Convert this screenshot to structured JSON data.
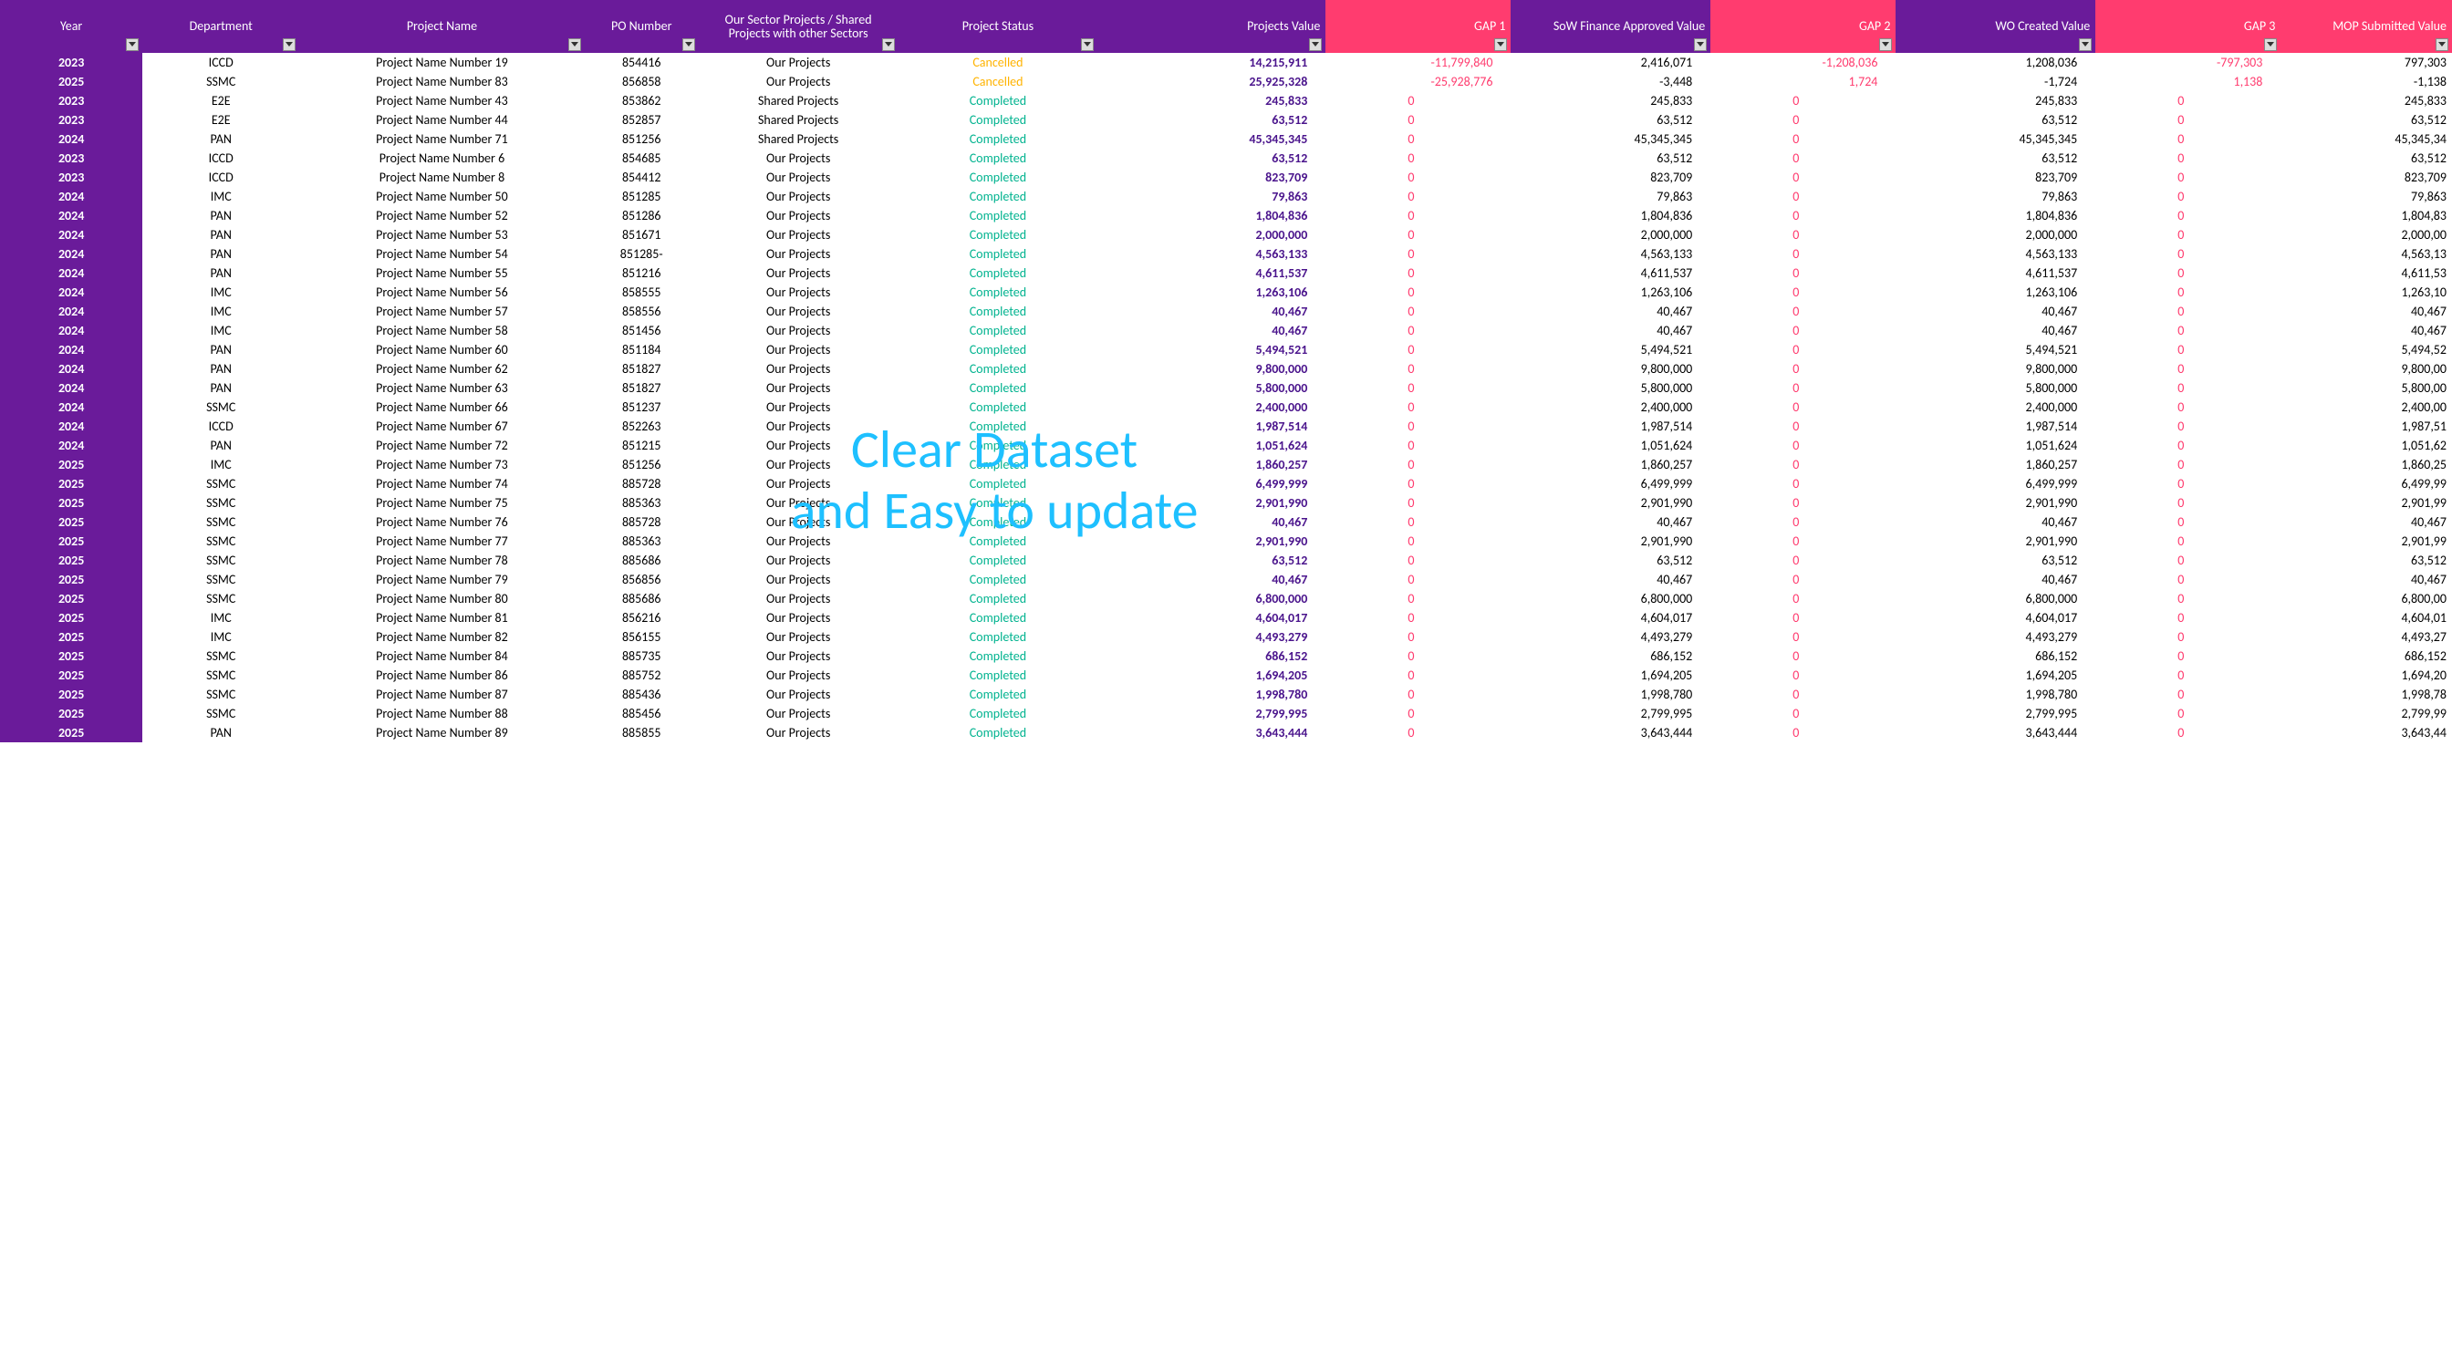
{
  "headers": [
    {
      "key": "year",
      "label": "Year",
      "cls": "c-year",
      "gap": false
    },
    {
      "key": "dept",
      "label": "Department",
      "cls": "c-dept",
      "gap": false
    },
    {
      "key": "pname",
      "label": "Project Name",
      "cls": "c-pname",
      "gap": false
    },
    {
      "key": "po",
      "label": "PO Number",
      "cls": "c-po",
      "gap": false
    },
    {
      "key": "sector",
      "label": "Our Sector Projects / Shared Projects with other Sectors",
      "cls": "c-sector",
      "gap": false
    },
    {
      "key": "status",
      "label": "Project Status",
      "cls": "c-status",
      "gap": false
    },
    {
      "key": "value",
      "label": "Projects Value",
      "cls": "c-value",
      "gap": false
    },
    {
      "key": "gap1",
      "label": "GAP 1",
      "cls": "c-gap",
      "gap": true
    },
    {
      "key": "sow",
      "label": "SoW Finance Approved Value",
      "cls": "c-money",
      "gap": false
    },
    {
      "key": "gap2",
      "label": "GAP 2",
      "cls": "c-gap",
      "gap": true
    },
    {
      "key": "wo",
      "label": "WO Created Value",
      "cls": "c-money",
      "gap": false
    },
    {
      "key": "gap3",
      "label": "GAP 3",
      "cls": "c-gap",
      "gap": true
    },
    {
      "key": "mop",
      "label": "MOP Submitted Value",
      "cls": "c-last",
      "gap": true
    }
  ],
  "watermark": "Clear Dataset\nand Easy to update",
  "rows": [
    {
      "year": "2023",
      "dept": "ICCD",
      "pname": "Project Name Number 19",
      "po": "854416",
      "sector": "Our Projects",
      "status": "Cancelled",
      "value": "14,215,911",
      "gap1": "-11,799,840",
      "sow": "2,416,071",
      "gap2": "-1,208,036",
      "wo": "1,208,036",
      "gap3": "-797,303",
      "mop": "797,303"
    },
    {
      "year": "2025",
      "dept": "SSMC",
      "pname": "Project Name Number 83",
      "po": "856858",
      "sector": "Our Projects",
      "status": "Cancelled",
      "value": "25,925,328",
      "gap1": "-25,928,776",
      "sow": "-3,448",
      "gap2": "1,724",
      "wo": "-1,724",
      "gap3": "1,138",
      "mop": "-1,138"
    },
    {
      "year": "2023",
      "dept": "E2E",
      "pname": "Project Name Number 43",
      "po": "853862",
      "sector": "Shared Projects",
      "status": "Completed",
      "value": "245,833",
      "gap1": "0",
      "sow": "245,833",
      "gap2": "0",
      "wo": "245,833",
      "gap3": "0",
      "mop": "245,833"
    },
    {
      "year": "2023",
      "dept": "E2E",
      "pname": "Project Name Number 44",
      "po": "852857",
      "sector": "Shared Projects",
      "status": "Completed",
      "value": "63,512",
      "gap1": "0",
      "sow": "63,512",
      "gap2": "0",
      "wo": "63,512",
      "gap3": "0",
      "mop": "63,512"
    },
    {
      "year": "2024",
      "dept": "PAN",
      "pname": "Project Name Number 71",
      "po": "851256",
      "sector": "Shared Projects",
      "status": "Completed",
      "value": "45,345,345",
      "gap1": "0",
      "sow": "45,345,345",
      "gap2": "0",
      "wo": "45,345,345",
      "gap3": "0",
      "mop": "45,345,34"
    },
    {
      "year": "2023",
      "dept": "ICCD",
      "pname": "Project Name Number 6",
      "po": "854685",
      "sector": "Our Projects",
      "status": "Completed",
      "value": "63,512",
      "gap1": "0",
      "sow": "63,512",
      "gap2": "0",
      "wo": "63,512",
      "gap3": "0",
      "mop": "63,512"
    },
    {
      "year": "2023",
      "dept": "ICCD",
      "pname": "Project Name Number 8",
      "po": "854412",
      "sector": "Our Projects",
      "status": "Completed",
      "value": "823,709",
      "gap1": "0",
      "sow": "823,709",
      "gap2": "0",
      "wo": "823,709",
      "gap3": "0",
      "mop": "823,709"
    },
    {
      "year": "2024",
      "dept": "IMC",
      "pname": "Project Name Number 50",
      "po": "851285",
      "sector": "Our Projects",
      "status": "Completed",
      "value": "79,863",
      "gap1": "0",
      "sow": "79,863",
      "gap2": "0",
      "wo": "79,863",
      "gap3": "0",
      "mop": "79,863"
    },
    {
      "year": "2024",
      "dept": "PAN",
      "pname": "Project Name Number 52",
      "po": "851286",
      "sector": "Our Projects",
      "status": "Completed",
      "value": "1,804,836",
      "gap1": "0",
      "sow": "1,804,836",
      "gap2": "0",
      "wo": "1,804,836",
      "gap3": "0",
      "mop": "1,804,83"
    },
    {
      "year": "2024",
      "dept": "PAN",
      "pname": "Project Name Number 53",
      "po": "851671",
      "sector": "Our Projects",
      "status": "Completed",
      "value": "2,000,000",
      "gap1": "0",
      "sow": "2,000,000",
      "gap2": "0",
      "wo": "2,000,000",
      "gap3": "0",
      "mop": "2,000,00"
    },
    {
      "year": "2024",
      "dept": "PAN",
      "pname": "Project Name Number 54",
      "po": "851285-",
      "sector": "Our Projects",
      "status": "Completed",
      "value": "4,563,133",
      "gap1": "0",
      "sow": "4,563,133",
      "gap2": "0",
      "wo": "4,563,133",
      "gap3": "0",
      "mop": "4,563,13"
    },
    {
      "year": "2024",
      "dept": "PAN",
      "pname": "Project Name Number 55",
      "po": "851216",
      "sector": "Our Projects",
      "status": "Completed",
      "value": "4,611,537",
      "gap1": "0",
      "sow": "4,611,537",
      "gap2": "0",
      "wo": "4,611,537",
      "gap3": "0",
      "mop": "4,611,53"
    },
    {
      "year": "2024",
      "dept": "IMC",
      "pname": "Project Name Number 56",
      "po": "858555",
      "sector": "Our Projects",
      "status": "Completed",
      "value": "1,263,106",
      "gap1": "0",
      "sow": "1,263,106",
      "gap2": "0",
      "wo": "1,263,106",
      "gap3": "0",
      "mop": "1,263,10"
    },
    {
      "year": "2024",
      "dept": "IMC",
      "pname": "Project Name Number 57",
      "po": "858556",
      "sector": "Our Projects",
      "status": "Completed",
      "value": "40,467",
      "gap1": "0",
      "sow": "40,467",
      "gap2": "0",
      "wo": "40,467",
      "gap3": "0",
      "mop": "40,467"
    },
    {
      "year": "2024",
      "dept": "IMC",
      "pname": "Project Name Number 58",
      "po": "851456",
      "sector": "Our Projects",
      "status": "Completed",
      "value": "40,467",
      "gap1": "0",
      "sow": "40,467",
      "gap2": "0",
      "wo": "40,467",
      "gap3": "0",
      "mop": "40,467"
    },
    {
      "year": "2024",
      "dept": "PAN",
      "pname": "Project Name Number 60",
      "po": "851184",
      "sector": "Our Projects",
      "status": "Completed",
      "value": "5,494,521",
      "gap1": "0",
      "sow": "5,494,521",
      "gap2": "0",
      "wo": "5,494,521",
      "gap3": "0",
      "mop": "5,494,52"
    },
    {
      "year": "2024",
      "dept": "PAN",
      "pname": "Project Name Number 62",
      "po": "851827",
      "sector": "Our Projects",
      "status": "Completed",
      "value": "9,800,000",
      "gap1": "0",
      "sow": "9,800,000",
      "gap2": "0",
      "wo": "9,800,000",
      "gap3": "0",
      "mop": "9,800,00"
    },
    {
      "year": "2024",
      "dept": "PAN",
      "pname": "Project Name Number 63",
      "po": "851827",
      "sector": "Our Projects",
      "status": "Completed",
      "value": "5,800,000",
      "gap1": "0",
      "sow": "5,800,000",
      "gap2": "0",
      "wo": "5,800,000",
      "gap3": "0",
      "mop": "5,800,00"
    },
    {
      "year": "2024",
      "dept": "SSMC",
      "pname": "Project Name Number 66",
      "po": "851237",
      "sector": "Our Projects",
      "status": "Completed",
      "value": "2,400,000",
      "gap1": "0",
      "sow": "2,400,000",
      "gap2": "0",
      "wo": "2,400,000",
      "gap3": "0",
      "mop": "2,400,00"
    },
    {
      "year": "2024",
      "dept": "ICCD",
      "pname": "Project Name Number 67",
      "po": "852263",
      "sector": "Our Projects",
      "status": "Completed",
      "value": "1,987,514",
      "gap1": "0",
      "sow": "1,987,514",
      "gap2": "0",
      "wo": "1,987,514",
      "gap3": "0",
      "mop": "1,987,51"
    },
    {
      "year": "2024",
      "dept": "PAN",
      "pname": "Project Name Number 72",
      "po": "851215",
      "sector": "Our Projects",
      "status": "Completed",
      "value": "1,051,624",
      "gap1": "0",
      "sow": "1,051,624",
      "gap2": "0",
      "wo": "1,051,624",
      "gap3": "0",
      "mop": "1,051,62"
    },
    {
      "year": "2025",
      "dept": "IMC",
      "pname": "Project Name Number 73",
      "po": "851256",
      "sector": "Our Projects",
      "status": "Completed",
      "value": "1,860,257",
      "gap1": "0",
      "sow": "1,860,257",
      "gap2": "0",
      "wo": "1,860,257",
      "gap3": "0",
      "mop": "1,860,25"
    },
    {
      "year": "2025",
      "dept": "SSMC",
      "pname": "Project Name Number 74",
      "po": "885728",
      "sector": "Our Projects",
      "status": "Completed",
      "value": "6,499,999",
      "gap1": "0",
      "sow": "6,499,999",
      "gap2": "0",
      "wo": "6,499,999",
      "gap3": "0",
      "mop": "6,499,99"
    },
    {
      "year": "2025",
      "dept": "SSMC",
      "pname": "Project Name Number 75",
      "po": "885363",
      "sector": "Our Projects",
      "status": "Completed",
      "value": "2,901,990",
      "gap1": "0",
      "sow": "2,901,990",
      "gap2": "0",
      "wo": "2,901,990",
      "gap3": "0",
      "mop": "2,901,99"
    },
    {
      "year": "2025",
      "dept": "SSMC",
      "pname": "Project Name Number 76",
      "po": "885728",
      "sector": "Our Projects",
      "status": "Completed",
      "value": "40,467",
      "gap1": "0",
      "sow": "40,467",
      "gap2": "0",
      "wo": "40,467",
      "gap3": "0",
      "mop": "40,467"
    },
    {
      "year": "2025",
      "dept": "SSMC",
      "pname": "Project Name Number 77",
      "po": "885363",
      "sector": "Our Projects",
      "status": "Completed",
      "value": "2,901,990",
      "gap1": "0",
      "sow": "2,901,990",
      "gap2": "0",
      "wo": "2,901,990",
      "gap3": "0",
      "mop": "2,901,99"
    },
    {
      "year": "2025",
      "dept": "SSMC",
      "pname": "Project Name Number 78",
      "po": "885686",
      "sector": "Our Projects",
      "status": "Completed",
      "value": "63,512",
      "gap1": "0",
      "sow": "63,512",
      "gap2": "0",
      "wo": "63,512",
      "gap3": "0",
      "mop": "63,512"
    },
    {
      "year": "2025",
      "dept": "SSMC",
      "pname": "Project Name Number 79",
      "po": "856856",
      "sector": "Our Projects",
      "status": "Completed",
      "value": "40,467",
      "gap1": "0",
      "sow": "40,467",
      "gap2": "0",
      "wo": "40,467",
      "gap3": "0",
      "mop": "40,467"
    },
    {
      "year": "2025",
      "dept": "SSMC",
      "pname": "Project Name Number 80",
      "po": "885686",
      "sector": "Our Projects",
      "status": "Completed",
      "value": "6,800,000",
      "gap1": "0",
      "sow": "6,800,000",
      "gap2": "0",
      "wo": "6,800,000",
      "gap3": "0",
      "mop": "6,800,00"
    },
    {
      "year": "2025",
      "dept": "IMC",
      "pname": "Project Name Number 81",
      "po": "856216",
      "sector": "Our Projects",
      "status": "Completed",
      "value": "4,604,017",
      "gap1": "0",
      "sow": "4,604,017",
      "gap2": "0",
      "wo": "4,604,017",
      "gap3": "0",
      "mop": "4,604,01"
    },
    {
      "year": "2025",
      "dept": "IMC",
      "pname": "Project Name Number 82",
      "po": "856155",
      "sector": "Our Projects",
      "status": "Completed",
      "value": "4,493,279",
      "gap1": "0",
      "sow": "4,493,279",
      "gap2": "0",
      "wo": "4,493,279",
      "gap3": "0",
      "mop": "4,493,27"
    },
    {
      "year": "2025",
      "dept": "SSMC",
      "pname": "Project Name Number 84",
      "po": "885735",
      "sector": "Our Projects",
      "status": "Completed",
      "value": "686,152",
      "gap1": "0",
      "sow": "686,152",
      "gap2": "0",
      "wo": "686,152",
      "gap3": "0",
      "mop": "686,152"
    },
    {
      "year": "2025",
      "dept": "SSMC",
      "pname": "Project Name Number 86",
      "po": "885752",
      "sector": "Our Projects",
      "status": "Completed",
      "value": "1,694,205",
      "gap1": "0",
      "sow": "1,694,205",
      "gap2": "0",
      "wo": "1,694,205",
      "gap3": "0",
      "mop": "1,694,20"
    },
    {
      "year": "2025",
      "dept": "SSMC",
      "pname": "Project Name Number 87",
      "po": "885436",
      "sector": "Our Projects",
      "status": "Completed",
      "value": "1,998,780",
      "gap1": "0",
      "sow": "1,998,780",
      "gap2": "0",
      "wo": "1,998,780",
      "gap3": "0",
      "mop": "1,998,78"
    },
    {
      "year": "2025",
      "dept": "SSMC",
      "pname": "Project Name Number 88",
      "po": "885456",
      "sector": "Our Projects",
      "status": "Completed",
      "value": "2,799,995",
      "gap1": "0",
      "sow": "2,799,995",
      "gap2": "0",
      "wo": "2,799,995",
      "gap3": "0",
      "mop": "2,799,99"
    },
    {
      "year": "2025",
      "dept": "PAN",
      "pname": "Project Name Number 89",
      "po": "885855",
      "sector": "Our Projects",
      "status": "Completed",
      "value": "3,643,444",
      "gap1": "0",
      "sow": "3,643,444",
      "gap2": "0",
      "wo": "3,643,444",
      "gap3": "0",
      "mop": "3,643,44"
    }
  ]
}
